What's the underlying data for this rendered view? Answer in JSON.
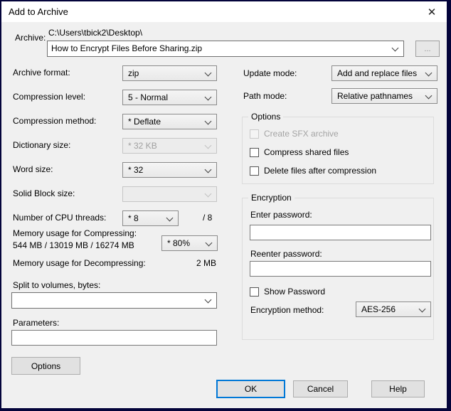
{
  "window": {
    "title": "Add to Archive"
  },
  "icons": {
    "close": "✕",
    "browse": "..."
  },
  "colors": {
    "window_border": "#03033a",
    "titlebar_bg": "#ffffff",
    "dialog_bg": "#f0f0f0",
    "focus_border": "#0078d7"
  },
  "archive": {
    "label": "Archive:",
    "dir": "C:\\Users\\tbick2\\Desktop\\",
    "filename": "How to Encrypt Files Before Sharing.zip"
  },
  "left": {
    "rows": [
      {
        "label": "Archive format:",
        "value": "zip"
      },
      {
        "label": "Compression level:",
        "value": "5 - Normal"
      },
      {
        "label": "Compression method:",
        "value": "* Deflate"
      },
      {
        "label": "Dictionary size:",
        "value": "* 32 KB"
      },
      {
        "label": "Word size:",
        "value": "* 32"
      },
      {
        "label": "Solid Block size:",
        "value": ""
      },
      {
        "label": "Number of CPU threads:",
        "value": "* 8",
        "suffix": "/ 8"
      }
    ],
    "memory_compressing": {
      "label": "Memory usage for Compressing:",
      "detail": "544 MB / 13019 MB / 16274 MB",
      "value": "* 80%"
    },
    "memory_decompressing": {
      "label": "Memory usage for Decompressing:",
      "value": "2 MB"
    },
    "split": {
      "label": "Split to volumes, bytes:",
      "value": ""
    },
    "parameters": {
      "label": "Parameters:",
      "value": ""
    },
    "options_button": "Options"
  },
  "right": {
    "update_mode": {
      "label": "Update mode:",
      "value": "Add and replace files"
    },
    "path_mode": {
      "label": "Path mode:",
      "value": "Relative pathnames"
    },
    "options_group": {
      "title": "Options",
      "items": [
        {
          "label": "Create SFX archive",
          "disabled": true,
          "checked": false
        },
        {
          "label": "Compress shared files",
          "disabled": false,
          "checked": false
        },
        {
          "label": "Delete files after compression",
          "disabled": false,
          "checked": false
        }
      ]
    },
    "encryption": {
      "title": "Encryption",
      "enter_password_label": "Enter password:",
      "enter_password_value": "",
      "reenter_password_label": "Reenter password:",
      "reenter_password_value": "",
      "show_password_label": "Show Password",
      "show_password_checked": false,
      "method_label": "Encryption method:",
      "method_value": "AES-256"
    }
  },
  "footer": {
    "ok": "OK",
    "cancel": "Cancel",
    "help": "Help"
  }
}
